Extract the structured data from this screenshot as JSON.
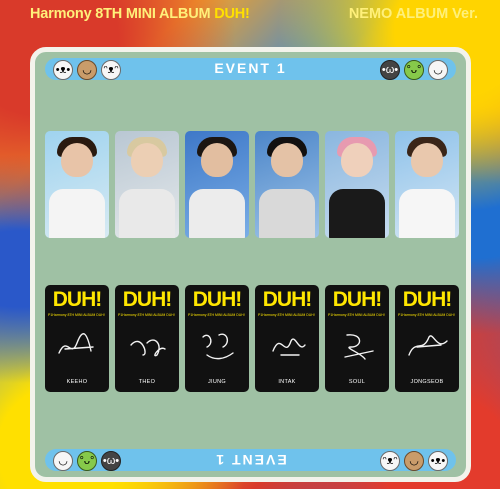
{
  "header": {
    "left_prefix": "Harmony 8TH MINI ALBUM ",
    "left_highlight": "DUH!",
    "right": "NEMO ALBUM Ver."
  },
  "event_title": "EVENT 1",
  "event_title_bottom": "EVENT 1",
  "photocards": {
    "logo": "DUH!",
    "subtitle": "P1Harmony 8TH MINI ALBUM DUH!",
    "members": [
      "KEEHO",
      "THEO",
      "JIUNG",
      "INTAK",
      "SOUL",
      "JONGSEOB"
    ]
  },
  "colors": {
    "card_bg": "#9fc1a4",
    "bar": "#6fc2ec",
    "logo_yellow": "#ffe600"
  }
}
